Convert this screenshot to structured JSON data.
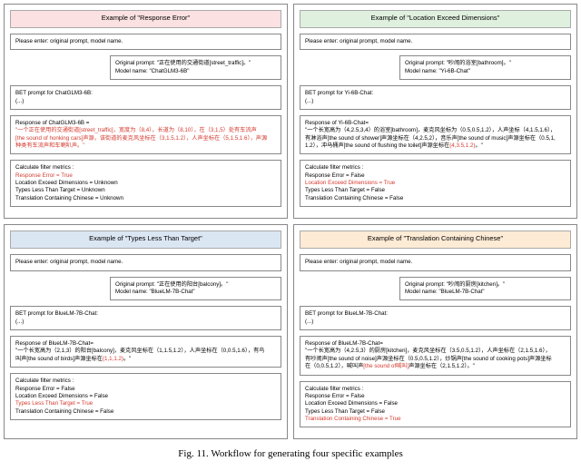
{
  "panels": {
    "p1": {
      "header": "Example of \"Response Error\"",
      "enter": "Please enter: original prompt, model name.",
      "origLabel": "Original prompt: \"正在使用的交通街道[street_traffic]。\"",
      "modelLabel": "Model name: \"ChatGLM3-6B\"",
      "betLabel": "BET prompt for ChatGLM3-6B:",
      "betVal": "(...)",
      "respLabel": "Response of ChatGLM3-6B =",
      "resp1": "\"一个正在使用的交通街道[street_traffic]，宽度为（8,4），长道为（8,10），在（3,1,5）处有车流声",
      "resp2": "[the sound of honking cars]声源，该街道的麦克风坐标在（3,1.5,1.2），人声坐标在（5,1.5,1.6），声源",
      "resp3": "种类有车流声和车喇叭声。\"",
      "filtLabel": "Calculate filter metrics :",
      "m1": "Response Error = True",
      "m2": "Location Exceed Dimensions = Unknown",
      "m3": "Types Less Than Target = Unknown",
      "m4": "Translation Containing Chinese = Unknown"
    },
    "p2": {
      "header": "Example of \"Location Exceed Dimensions\"",
      "enter": "Please enter: original prompt, model name.",
      "origLabel": "Original prompt: \"吵闹的浴室[bathroom]。\"",
      "modelLabel": "Model name: \"Yi-6B-Chat\"",
      "betLabel": "BET prompt for Yi-6B-Chat:",
      "betVal": "(...)",
      "respLabel": "Response of Yi-6B-Chat=",
      "resp1": "\"一个长宽高为（4,2.5,3,4）的浴室[bathroom]，麦克风坐标为（0.5,0.5,1.2），人声坐标（4,1.5,1.6），",
      "resp2": "有淋浴声[the sound of shower]声源坐标在（4,2.5,2），音乐声[the sound of music]声源坐标在（0.5,1,",
      "resp3a": "1.2），冲马桶声[the sound of flushing the toilet]声源坐标在",
      "resp3b": "(4,3.5,1.2)",
      "resp3c": "。\"",
      "filtLabel": "Calculate filter metrics :",
      "m1": "Response Error = False",
      "m2": "Location Exceed Dimensions = True",
      "m3": "Types Less Than Target = False",
      "m4": "Translation Containing Chinese = False"
    },
    "p3": {
      "header": "Example of \"Types Less Than Target\"",
      "enter": "Please enter: original prompt, model name.",
      "origLabel": "Original prompt: \"正在使用的阳台[balcony]。\"",
      "modelLabel": "Model name: \"BlueLM-7B-Chat\"",
      "betLabel": "BET prompt for BlueLM-7B-Chat:",
      "betVal": "(...)",
      "respLabel": "Response of BlueLM-7B-Chat=",
      "resp1": "\"一个长宽高为（2,1,3）的阳台[balcony]，麦克风坐标在（1,1.5,1.2），人声坐标在（0,0.5,1.6），有鸟",
      "resp2a": "叫声[the sound of birds]声源坐标在",
      "resp2b": "(1,1,1.2)",
      "resp2c": "。\"",
      "filtLabel": "Calculate filter metrics :",
      "m1": "Response Error = False",
      "m2": "Location Exceed Dimensions = False",
      "m3": "Types Less Than Target = True",
      "m4": "Translation Containing Chinese = False"
    },
    "p4": {
      "header": "Example of \"Translation Containing Chinese\"",
      "enter": "Please enter: original prompt, model name.",
      "origLabel": "Original prompt: \"吵闹的厨房[kitchen]。\"",
      "modelLabel": "Model name: \"BlueLM-7B-Chat\"",
      "betLabel": "BET prompt for BlueLM-7B-Chat:",
      "betVal": "(...)",
      "respLabel": "Response of BlueLM-7B-Chat=",
      "resp1": "\"一个长宽高为（4,2.5,3）的厨房[kitchen]，麦克风坐标在（3.5,0.5,1.2），人声坐标在（2,1.5,1.6），",
      "resp2": "有吵闹声[the sound of noise]声源坐标在（0.5,0.5,1.2），炒锅声[the sound of cooking pots]声源坐标",
      "resp3a": "在（0,0.5,1.2），喊叫声",
      "resp3b": "[the sound of喊叫]",
      "resp3c": "声源坐标在（2,1.5,1.2）。\"",
      "filtLabel": "Calculate filter metrics :",
      "m1": "Response Error = False",
      "m2": "Location Exceed Dimensions = False",
      "m3": "Types Less Than Target = False",
      "m4": "Translation Containing Chinese = True"
    }
  },
  "caption": "Fig. 11. Workflow for generating four specific examples"
}
